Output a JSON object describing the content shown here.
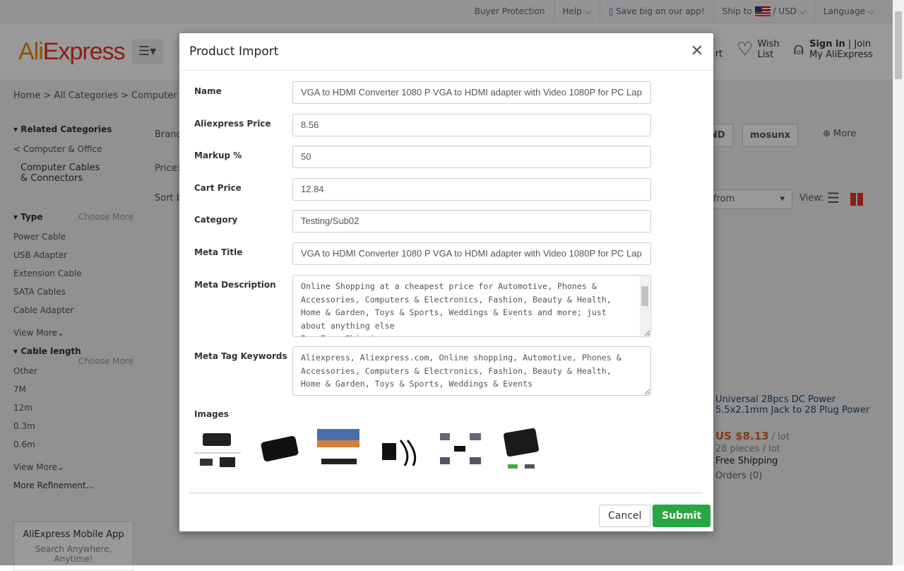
{
  "topbar": {
    "buyer_protection": "Buyer Protection",
    "help": "Help",
    "app": "Save big on our app!",
    "ship_to": "Ship to",
    "currency": "USD",
    "language": "Language"
  },
  "header": {
    "logo": "AliExpress",
    "cart": "rt",
    "wish_1": "Wish",
    "wish_2": "List",
    "sign_in": "Sign in",
    "join": "Join",
    "my": "My AliExpress"
  },
  "breadcrumb": "Home > All Categories > Computer & Offi",
  "sidebar": {
    "related": "Related Categories",
    "parent": "< Computer & Office",
    "current": "Computer Cables & Connectors",
    "type_title": "Type",
    "choose_more": "Choose More",
    "types": [
      "Power Cable",
      "USB Adapter",
      "Extension Cable",
      "SATA Cables",
      "Cable Adapter"
    ],
    "view_more": "View More",
    "cable_title": "Cable length",
    "cables": [
      "Other",
      "7M",
      "12m",
      "0.3m",
      "0.6m"
    ],
    "more_refinement": "More Refinement...",
    "app_title": "AliExpress Mobile App",
    "app_sub": "Search Anywhere, Anytime!"
  },
  "main": {
    "brand": "Brand",
    "price": "Price:",
    "sort": "Sort b",
    "brand_1": "IND",
    "brand_2": "mosunx",
    "more": "More",
    "ship_from": "from",
    "view": "View:"
  },
  "product": {
    "title": "Universal 28pcs DC Power 5.5x2.1mm Jack to 28 Plug Power",
    "price": "US $8.13",
    "unit": "/ lot",
    "pieces": "28 pieces / lot",
    "shipping": "Free Shipping",
    "orders": "Orders (0)"
  },
  "modal": {
    "title": "Product Import",
    "fields": {
      "name": {
        "label": "Name",
        "value": "VGA to HDMI Converter 1080 P VGA to HDMI adapter with Video 1080P for PC Lap"
      },
      "price": {
        "label": "Aliexpress Price",
        "value": "8.56"
      },
      "markup": {
        "label": "Markup %",
        "value": "50"
      },
      "cart_price": {
        "label": "Cart Price",
        "value": "12.84"
      },
      "category": {
        "label": "Category",
        "value": "Testing/Sub02"
      },
      "meta_title": {
        "label": "Meta Title",
        "value": "VGA to HDMI Converter 1080 P VGA to HDMI adapter with Video 1080P for PC Lap"
      },
      "meta_description": {
        "label": "Meta Description",
        "value": "Online Shopping at a cheapest price for Automotive, Phones & Accessories, Computers & Electronics, Fashion, Beauty & Health, Home & Garden, Toys & Sports, Weddings & Events and more; just about anything else\nBuy Free Shipping ..."
      },
      "meta_keywords": {
        "label": "Meta Tag Keywords",
        "value": "Aliexpress, Aliexpress.com, Online shopping, Automotive, Phones & Accessories, Computers & Electronics, Fashion, Beauty & Health, Home & Garden, Toys & Sports, Weddings & Events"
      }
    },
    "images_label": "Images",
    "image_count": 6,
    "cancel": "Cancel",
    "submit": "Submit"
  },
  "colors": {
    "accent_green": "#28a745",
    "ali_orange": "#f08a00",
    "ali_red": "#e43225"
  }
}
